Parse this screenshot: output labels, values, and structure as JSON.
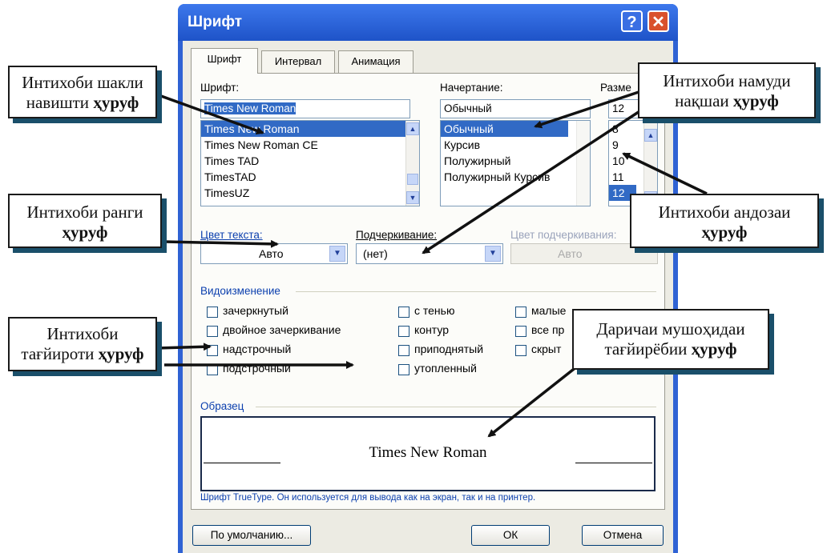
{
  "dialog": {
    "title": "Шрифт",
    "help_icon": "?",
    "close_icon": "✕",
    "tabs": [
      {
        "label": "Шрифт",
        "active": true
      },
      {
        "label": "Интервал",
        "active": false
      },
      {
        "label": "Анимация",
        "active": false
      }
    ],
    "font": {
      "label": "Шрифт:",
      "value": "Times New Roman",
      "items": [
        "Times New Roman",
        "Times New Roman CE",
        "Times TAD",
        "TimesTAD",
        "TimesUZ"
      ]
    },
    "style": {
      "label": "Начертание:",
      "value": "Обычный",
      "items": [
        "Обычный",
        "Курсив",
        "Полужирный",
        "Полужирный Курсив"
      ]
    },
    "size": {
      "label": "Разме",
      "value": "12",
      "items": [
        "8",
        "9",
        "10",
        "11",
        "12"
      ]
    },
    "color": {
      "label": "Цвет текста:",
      "value": "Авто"
    },
    "underline": {
      "label": "Подчеркивание:",
      "value": "(нет)"
    },
    "underline_color": {
      "label": "Цвет подчеркивания:",
      "value": "Авто"
    },
    "effects": {
      "label": "Видоизменение",
      "col1": [
        "зачеркнутый",
        "двойное зачеркивание",
        "надстрочный",
        "подстрочный"
      ],
      "col2": [
        "с тенью",
        "контур",
        "приподнятый",
        "утопленный"
      ],
      "col3": [
        "малые",
        "все пр",
        "скрыт"
      ]
    },
    "sample": {
      "label": "Образец",
      "text": "Times New Roman",
      "note": "Шрифт TrueType. Он используется для вывода как на экран, так и на принтер."
    },
    "buttons": {
      "default": "По умолчанию...",
      "ok": "ОК",
      "cancel": "Отмена"
    }
  },
  "annotations": {
    "font_shape": {
      "line1": "Интихоби шакли",
      "line2a": "навишти ",
      "line2b": "ҳуруф"
    },
    "style": {
      "line1": "Интихоби намуди",
      "line2a": "нақшаи ",
      "line2b": "ҳуруф"
    },
    "color": {
      "line1": "Интихоби ранги",
      "line2b": "ҳуруф"
    },
    "size": {
      "line1": "Интихоби андозаи",
      "line2b": "ҳуруф"
    },
    "effects": {
      "line1": "Интихоби",
      "line2a": "тағйироти ",
      "line2b": "ҳуруф"
    },
    "preview": {
      "line1": "Даричаи мушоҳидаи",
      "line2a": "тағйирёбии ",
      "line2b": "ҳуруф"
    }
  }
}
